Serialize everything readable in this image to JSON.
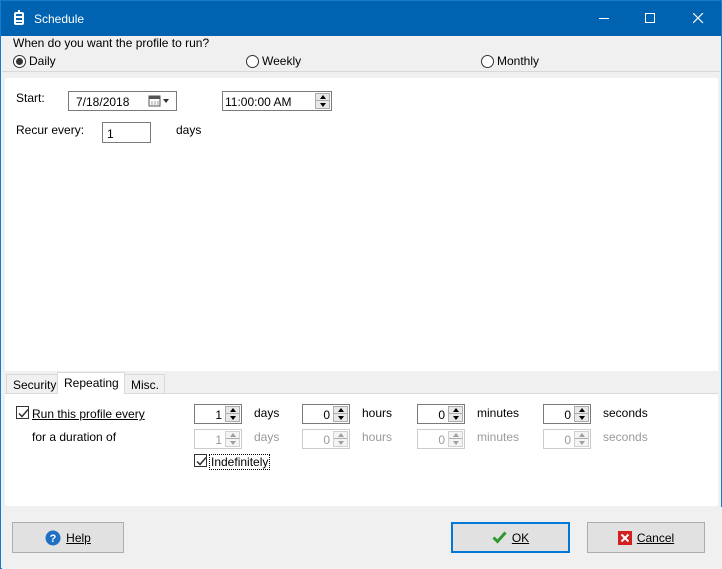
{
  "window": {
    "title": "Schedule",
    "icon": "tray-icon",
    "controls": [
      "minimize-icon",
      "maximize-icon",
      "close-icon"
    ]
  },
  "frequency": {
    "question": "When do you want the profile to run?",
    "options": [
      {
        "label": "Daily",
        "selected": true
      },
      {
        "label": "Weekly",
        "selected": false
      },
      {
        "label": "Monthly",
        "selected": false
      }
    ]
  },
  "daily": {
    "start_label": "Start:",
    "start_date": "7/18/2018",
    "start_time": "11:00:00 AM",
    "recur_label": "Recur every:",
    "recur_value": "1",
    "recur_unit": "days"
  },
  "tabs": [
    {
      "label": "Security",
      "active": false
    },
    {
      "label": "Repeating",
      "active": true
    },
    {
      "label": "Misc.",
      "active": false
    }
  ],
  "repeating": {
    "run_every_label": "Run this profile every",
    "run_every_checked": true,
    "duration_label": "for a duration of",
    "run_every": [
      {
        "value": "1",
        "unit": "days"
      },
      {
        "value": "0",
        "unit": "hours"
      },
      {
        "value": "0",
        "unit": "minutes"
      },
      {
        "value": "0",
        "unit": "seconds"
      }
    ],
    "duration": [
      {
        "value": "1",
        "unit": "days"
      },
      {
        "value": "0",
        "unit": "hours"
      },
      {
        "value": "0",
        "unit": "minutes"
      },
      {
        "value": "0",
        "unit": "seconds"
      }
    ],
    "indefinitely_label": "Indefinitely",
    "indefinitely_checked": true
  },
  "buttons": {
    "help": "Help",
    "ok": "OK",
    "cancel": "Cancel"
  },
  "colors": {
    "titlebar": "#0063b1",
    "accent": "#0078d7",
    "ok_icon": "#2e9a2e",
    "cancel_icon": "#d42020",
    "help_icon": "#1f6fc5"
  }
}
